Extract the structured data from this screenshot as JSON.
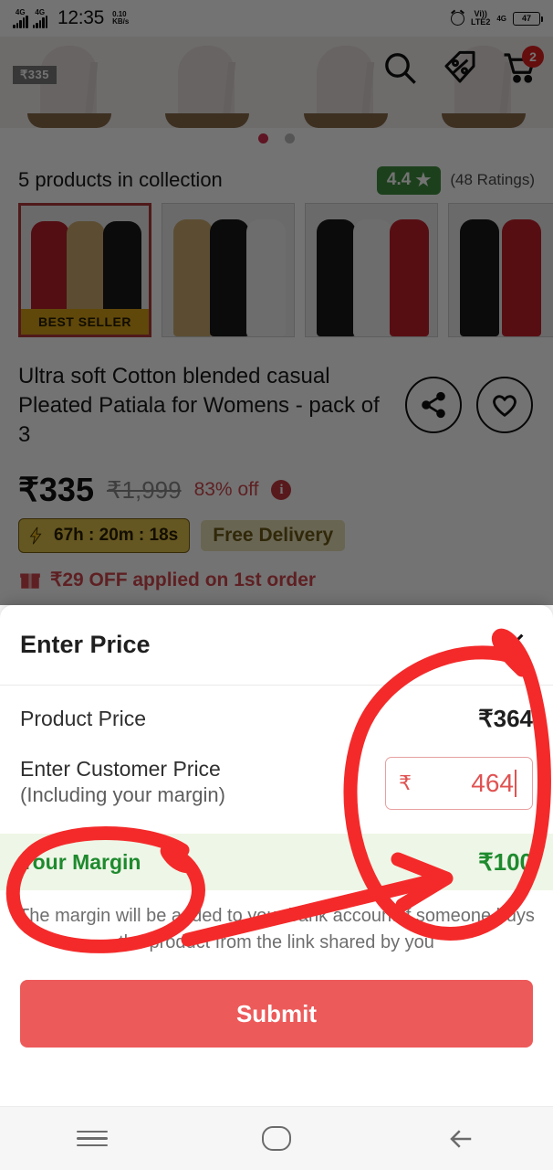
{
  "status_bar": {
    "sim1_label": "4G",
    "sim2_label": "4G",
    "time": "12:35",
    "net_speed_value": "0.10",
    "net_speed_unit": "KB/s",
    "carrier_top": "Vi))",
    "carrier_bottom": "LTE2",
    "network_type": "4G",
    "battery_percent": "47"
  },
  "product_page": {
    "hero_price_tag": "₹335",
    "cart_badge": "2",
    "collection_title": "5 products in collection",
    "rating_value": "4.4",
    "rating_star": "★",
    "ratings_count": "(48 Ratings)",
    "best_seller_label": "BEST SELLER",
    "product_title": "Ultra soft Cotton blended casual Pleated Patiala for Womens - pack of 3",
    "price_now": "₹335",
    "price_mrp": "₹1,999",
    "discount": "83% off",
    "info_icon_label": "i",
    "timer": "67h : 20m : 18s",
    "free_delivery": "Free Delivery",
    "first_order_offer": "₹29 OFF applied on 1st order",
    "icons": {
      "search": "search-icon",
      "offers": "discount-tag-icon",
      "cart": "cart-icon",
      "share": "share-icon",
      "wishlist": "heart-icon"
    }
  },
  "sheet": {
    "title": "Enter Price",
    "close_icon": "close-icon",
    "product_price_label": "Product Price",
    "product_price_value": "₹364",
    "customer_price_label": "Enter Customer Price",
    "customer_price_sublabel": "(Including your margin)",
    "customer_price_currency": "₹",
    "customer_price_value": "464",
    "margin_label": "Your Margin",
    "margin_value": "₹100",
    "note": "The margin will be added to your bank account if someone buys the product from the link shared by you",
    "submit_label": "Submit"
  },
  "nav_bar": {
    "recents": "recents-icon",
    "home": "home-icon",
    "back": "back-icon"
  },
  "colors": {
    "accent_red": "#ed5a5a",
    "margin_green": "#1e8a2e",
    "rating_green": "#3f8f3f",
    "annotation_red": "#f42a2a",
    "timer_gold": "#e0c14a"
  }
}
